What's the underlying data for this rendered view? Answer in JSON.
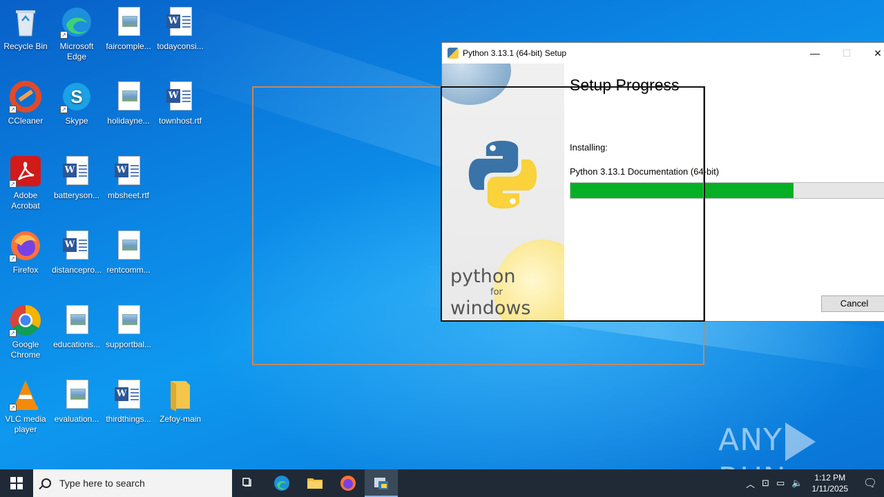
{
  "desktop": {
    "icons": [
      {
        "label": "Recycle Bin",
        "icon": "recycle-bin-icon"
      },
      {
        "label": "Microsoft Edge",
        "icon": "edge-icon"
      },
      {
        "label": "faircomple...",
        "icon": "image-file-icon"
      },
      {
        "label": "todayconsi...",
        "icon": "word-doc-icon"
      },
      {
        "label": "CCleaner",
        "icon": "ccleaner-icon"
      },
      {
        "label": "Skype",
        "icon": "skype-icon"
      },
      {
        "label": "holidayne...",
        "icon": "image-file-icon"
      },
      {
        "label": "townhost.rtf",
        "icon": "word-doc-icon"
      },
      {
        "label": "Adobe Acrobat",
        "icon": "acrobat-icon"
      },
      {
        "label": "batteryson...",
        "icon": "word-doc-icon"
      },
      {
        "label": "mbsheet.rtf",
        "icon": "word-doc-icon"
      },
      {
        "label": "Firefox",
        "icon": "firefox-icon"
      },
      {
        "label": "distancepro...",
        "icon": "word-doc-icon"
      },
      {
        "label": "rentcomm...",
        "icon": "image-file-icon"
      },
      {
        "label": "Google Chrome",
        "icon": "chrome-icon"
      },
      {
        "label": "educations...",
        "icon": "image-file-icon"
      },
      {
        "label": "supportbal...",
        "icon": "image-file-icon"
      },
      {
        "label": "VLC media player",
        "icon": "vlc-icon"
      },
      {
        "label": "evaluation...",
        "icon": "image-file-icon"
      },
      {
        "label": "thirdthings...",
        "icon": "word-doc-icon"
      },
      {
        "label": "Zefoy-main",
        "icon": "folder-icon"
      }
    ]
  },
  "setup_window": {
    "title": "Python 3.13.1 (64-bit) Setup",
    "minimize": "—",
    "maximize": "☐",
    "close": "✕",
    "heading": "Setup Progress",
    "installing_label": "Installing:",
    "current_item": "Python 3.13.1 Documentation (64-bit)",
    "progress_fraction": 0.705,
    "cancel_label": "Cancel",
    "branding": {
      "line1": "python",
      "line2": "for",
      "line3": "windows"
    }
  },
  "watermark": {
    "left": "ANY",
    "right": "RUN"
  },
  "taskbar": {
    "search_placeholder": "Type here to search",
    "time": "1:12 PM",
    "date": "1/11/2025"
  }
}
